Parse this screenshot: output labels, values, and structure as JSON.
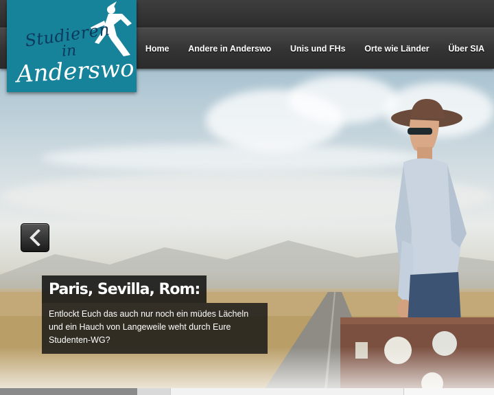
{
  "logo": {
    "line1": "Studieren",
    "line2": "in",
    "line3": "Anderswo",
    "background": "#16839a"
  },
  "nav": {
    "items": [
      {
        "label": "Home"
      },
      {
        "label": "Andere in Anderswo"
      },
      {
        "label": "Unis und FHs"
      },
      {
        "label": "Orte wie Länder"
      },
      {
        "label": "Über SIA"
      }
    ]
  },
  "slider": {
    "prev_icon": "chevron-left-icon",
    "caption_title": "Paris, Sevilla, Rom:",
    "caption_text": "Entlockt Euch das auch nur noch ein müdes Lächeln und ein Hauch von Langeweile weht durch Eure Studenten-WG?"
  }
}
